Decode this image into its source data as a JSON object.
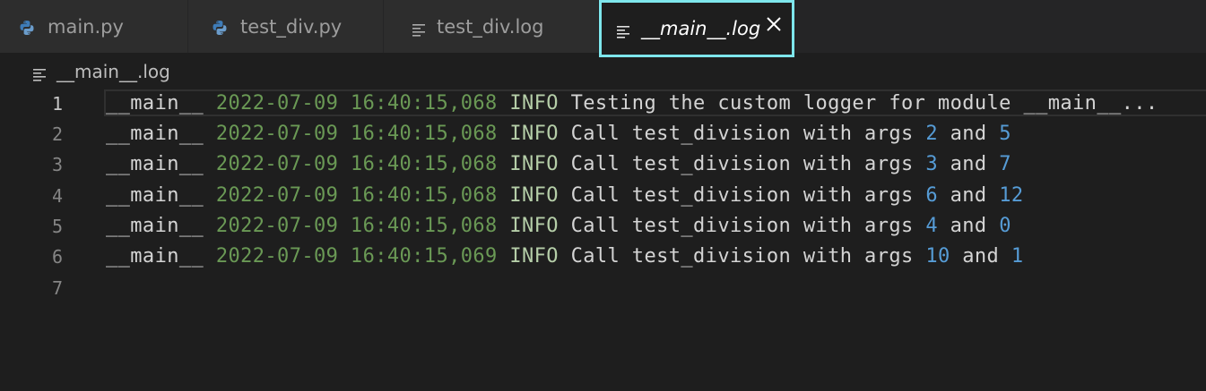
{
  "tabs": [
    {
      "label": "main.py",
      "icon": "python-icon"
    },
    {
      "label": "test_div.py",
      "icon": "python-icon"
    },
    {
      "label": "test_div.log",
      "icon": "text-lines-icon"
    },
    {
      "label": "__main__.log",
      "icon": "text-lines-icon",
      "active": true
    }
  ],
  "breadcrumb": {
    "file": "__main__.log"
  },
  "line_numbers": [
    "1",
    "2",
    "3",
    "4",
    "5",
    "6",
    "7"
  ],
  "lines": [
    {
      "logger": "__main__",
      "timestamp": "2022-07-09 16:40:15,068",
      "level": "INFO",
      "message": "Testing the custom logger for module __main__..."
    },
    {
      "logger": "__main__",
      "timestamp": "2022-07-09 16:40:15,068",
      "level": "INFO",
      "message": "Call test_division with args",
      "a": "2",
      "and": "and",
      "b": "5"
    },
    {
      "logger": "__main__",
      "timestamp": "2022-07-09 16:40:15,068",
      "level": "INFO",
      "message": "Call test_division with args",
      "a": "3",
      "and": "and",
      "b": "7"
    },
    {
      "logger": "__main__",
      "timestamp": "2022-07-09 16:40:15,068",
      "level": "INFO",
      "message": "Call test_division with args",
      "a": "6",
      "and": "and",
      "b": "12"
    },
    {
      "logger": "__main__",
      "timestamp": "2022-07-09 16:40:15,068",
      "level": "INFO",
      "message": "Call test_division with args",
      "a": "4",
      "and": "and",
      "b": "0"
    },
    {
      "logger": "__main__",
      "timestamp": "2022-07-09 16:40:15,069",
      "level": "INFO",
      "message": "Call test_division with args",
      "a": "10",
      "and": "and",
      "b": "1"
    }
  ],
  "colors": {
    "accent_border": "#7ee6ec",
    "timestamp": "#6a9955",
    "number": "#569cd6",
    "level": "#b5cea8"
  }
}
